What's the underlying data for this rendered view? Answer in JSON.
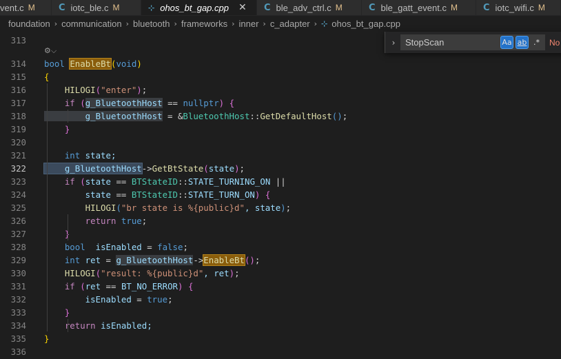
{
  "tabs": [
    {
      "name": "vent.c",
      "modified": "M",
      "icon": "C",
      "active": false,
      "italic": false,
      "partial": true
    },
    {
      "name": "iotc_ble.c",
      "modified": "M",
      "icon": "C",
      "active": false,
      "italic": false
    },
    {
      "name": "ohos_bt_gap.cpp",
      "modified": "",
      "icon": "⊹",
      "active": true,
      "italic": true,
      "close": "✕"
    },
    {
      "name": "ble_adv_ctrl.c",
      "modified": "M",
      "icon": "C",
      "active": false,
      "italic": false
    },
    {
      "name": "ble_gatt_event.c",
      "modified": "M",
      "icon": "C",
      "active": false,
      "italic": false
    },
    {
      "name": "iotc_wifi.c",
      "modified": "M",
      "icon": "C",
      "active": false,
      "italic": false
    }
  ],
  "breadcrumb": {
    "items": [
      "foundation",
      "communication",
      "bluetooth",
      "frameworks",
      "inner",
      "c_adapter"
    ],
    "file_icon": "⊹",
    "file": "ohos_bt_gap.cpp",
    "separator": "›"
  },
  "find": {
    "toggle_icon": "›",
    "query": "StopScan",
    "match_case": "Aa",
    "whole_word": "ab",
    "regex": ".*",
    "result": "No"
  },
  "codelens": "⚙⌵",
  "current_line": "322",
  "lines": [
    {
      "n": "313",
      "tokens": []
    },
    {
      "n": "314",
      "tokens": [
        {
          "t": "bool",
          "c": "kw"
        },
        {
          "t": " ",
          "c": "plain"
        },
        {
          "t": "EnableBt",
          "c": "fn hl-find"
        },
        {
          "t": "(",
          "c": "br1"
        },
        {
          "t": "void",
          "c": "kw"
        },
        {
          "t": ")",
          "c": "br1"
        }
      ]
    },
    {
      "n": "315",
      "tokens": [
        {
          "t": "{",
          "c": "br1"
        }
      ]
    },
    {
      "n": "316",
      "tokens": [
        {
          "t": "    HILOGI",
          "c": "fn"
        },
        {
          "t": "(",
          "c": "br2"
        },
        {
          "t": "\"enter\"",
          "c": "str"
        },
        {
          "t": ")",
          "c": "br2"
        },
        {
          "t": ";",
          "c": "plain"
        }
      ]
    },
    {
      "n": "317",
      "tokens": [
        {
          "t": "    if",
          "c": "ctl"
        },
        {
          "t": " ",
          "c": "plain"
        },
        {
          "t": "(",
          "c": "br2"
        },
        {
          "t": "g_BluetoothHost",
          "c": "var hl-sel"
        },
        {
          "t": " == ",
          "c": "plain"
        },
        {
          "t": "nullptr",
          "c": "kw"
        },
        {
          "t": ")",
          "c": "br2"
        },
        {
          "t": " ",
          "c": "plain"
        },
        {
          "t": "{",
          "c": "br2"
        }
      ]
    },
    {
      "n": "318",
      "tokens": [
        {
          "t": "        g_BluetoothHost",
          "c": "var hl-sel"
        },
        {
          "t": " = &",
          "c": "plain"
        },
        {
          "t": "BluetoothHost",
          "c": "type"
        },
        {
          "t": "::",
          "c": "plain"
        },
        {
          "t": "GetDefaultHost",
          "c": "fn"
        },
        {
          "t": "()",
          "c": "kw"
        },
        {
          "t": ";",
          "c": "plain"
        }
      ]
    },
    {
      "n": "319",
      "tokens": [
        {
          "t": "    }",
          "c": "br2"
        }
      ]
    },
    {
      "n": "320",
      "tokens": []
    },
    {
      "n": "321",
      "tokens": [
        {
          "t": "    int",
          "c": "kw"
        },
        {
          "t": " state;",
          "c": "var"
        }
      ]
    },
    {
      "n": "322",
      "tokens": [
        {
          "t": "    g_BluetoothHost",
          "c": "var hl-word"
        },
        {
          "t": "->",
          "c": "plain"
        },
        {
          "t": "GetBtState",
          "c": "fn"
        },
        {
          "t": "(",
          "c": "br2"
        },
        {
          "t": "state",
          "c": "var"
        },
        {
          "t": ")",
          "c": "br2"
        },
        {
          "t": ";",
          "c": "plain"
        }
      ]
    },
    {
      "n": "323",
      "tokens": [
        {
          "t": "    if",
          "c": "ctl"
        },
        {
          "t": " ",
          "c": "plain"
        },
        {
          "t": "(",
          "c": "br2"
        },
        {
          "t": "state",
          "c": "var"
        },
        {
          "t": " == ",
          "c": "plain"
        },
        {
          "t": "BTStateID",
          "c": "type"
        },
        {
          "t": "::",
          "c": "plain"
        },
        {
          "t": "STATE_TURNING_ON",
          "c": "var"
        },
        {
          "t": " ||",
          "c": "plain"
        }
      ]
    },
    {
      "n": "324",
      "tokens": [
        {
          "t": "        state",
          "c": "var"
        },
        {
          "t": " == ",
          "c": "plain"
        },
        {
          "t": "BTStateID",
          "c": "type"
        },
        {
          "t": "::",
          "c": "plain"
        },
        {
          "t": "STATE_TURN_ON",
          "c": "var"
        },
        {
          "t": ")",
          "c": "br2"
        },
        {
          "t": " ",
          "c": "plain"
        },
        {
          "t": "{",
          "c": "br2"
        }
      ]
    },
    {
      "n": "325",
      "tokens": [
        {
          "t": "        HILOGI",
          "c": "fn"
        },
        {
          "t": "(",
          "c": "kw"
        },
        {
          "t": "\"br state is %{public}d\"",
          "c": "str"
        },
        {
          "t": ", state",
          "c": "var"
        },
        {
          "t": ")",
          "c": "kw"
        },
        {
          "t": ";",
          "c": "plain"
        }
      ]
    },
    {
      "n": "326",
      "tokens": [
        {
          "t": "        return",
          "c": "ctl"
        },
        {
          "t": " ",
          "c": "plain"
        },
        {
          "t": "true",
          "c": "kw"
        },
        {
          "t": ";",
          "c": "plain"
        }
      ]
    },
    {
      "n": "327",
      "tokens": [
        {
          "t": "    }",
          "c": "br2"
        }
      ]
    },
    {
      "n": "328",
      "tokens": [
        {
          "t": "    bool",
          "c": "kw"
        },
        {
          "t": "  isEnabled",
          "c": "var"
        },
        {
          "t": " = ",
          "c": "plain"
        },
        {
          "t": "false",
          "c": "kw"
        },
        {
          "t": ";",
          "c": "plain"
        }
      ]
    },
    {
      "n": "329",
      "tokens": [
        {
          "t": "    int",
          "c": "kw"
        },
        {
          "t": " ret",
          "c": "var"
        },
        {
          "t": " = ",
          "c": "plain"
        },
        {
          "t": "g_BluetoothHost",
          "c": "var hl-sel"
        },
        {
          "t": "->",
          "c": "plain"
        },
        {
          "t": "EnableBt",
          "c": "fn hl-find"
        },
        {
          "t": "()",
          "c": "br2"
        },
        {
          "t": ";",
          "c": "plain"
        }
      ]
    },
    {
      "n": "330",
      "tokens": [
        {
          "t": "    HILOGI",
          "c": "fn"
        },
        {
          "t": "(",
          "c": "br2"
        },
        {
          "t": "\"result: %{public}d\"",
          "c": "str"
        },
        {
          "t": ", ret",
          "c": "var"
        },
        {
          "t": ")",
          "c": "br2"
        },
        {
          "t": ";",
          "c": "plain"
        }
      ]
    },
    {
      "n": "331",
      "tokens": [
        {
          "t": "    if",
          "c": "ctl"
        },
        {
          "t": " ",
          "c": "plain"
        },
        {
          "t": "(",
          "c": "br2"
        },
        {
          "t": "ret",
          "c": "var"
        },
        {
          "t": " == ",
          "c": "plain"
        },
        {
          "t": "BT_NO_ERROR",
          "c": "var"
        },
        {
          "t": ")",
          "c": "br2"
        },
        {
          "t": " ",
          "c": "plain"
        },
        {
          "t": "{",
          "c": "br2"
        }
      ]
    },
    {
      "n": "332",
      "tokens": [
        {
          "t": "        isEnabled",
          "c": "var"
        },
        {
          "t": " = ",
          "c": "plain"
        },
        {
          "t": "true",
          "c": "kw"
        },
        {
          "t": ";",
          "c": "plain"
        }
      ]
    },
    {
      "n": "333",
      "tokens": [
        {
          "t": "    }",
          "c": "br2"
        }
      ]
    },
    {
      "n": "334",
      "tokens": [
        {
          "t": "    return",
          "c": "ctl"
        },
        {
          "t": " isEnabled;",
          "c": "var"
        }
      ]
    },
    {
      "n": "335",
      "tokens": [
        {
          "t": "}",
          "c": "br1"
        }
      ]
    },
    {
      "n": "336",
      "tokens": []
    }
  ]
}
